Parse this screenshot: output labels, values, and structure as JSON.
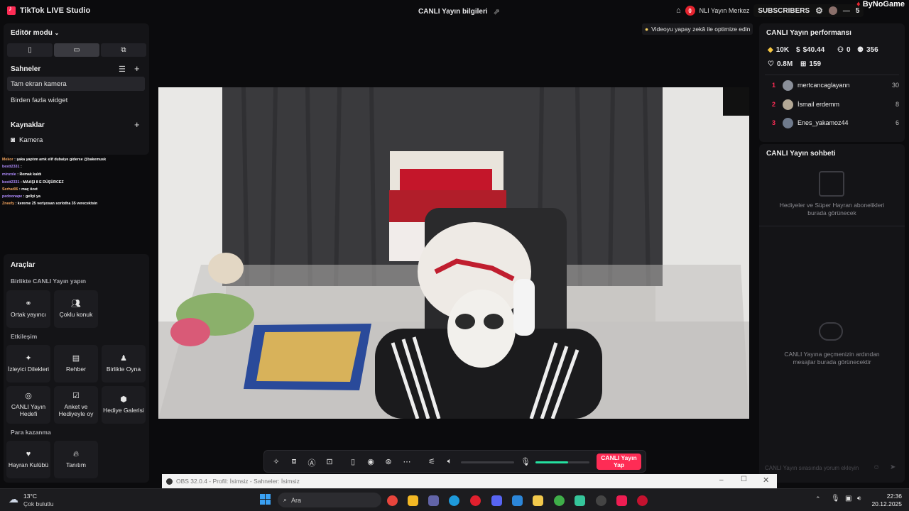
{
  "app": {
    "title": "TikTok LIVE Studio",
    "center_title": "CANLI Yayın bilgileri"
  },
  "top_right": {
    "notif_count": "0",
    "center_label": "NLI Yayın Merkez",
    "subs_label": "SUBSCRIBERS",
    "counter": "5",
    "brand": "ByNoGame"
  },
  "left": {
    "editor_mode": "Editör modu",
    "scenes_title": "Sahneler",
    "scenes": [
      "Tam ekran kamera",
      "Birden fazla widget"
    ],
    "sources_title": "Kaynaklar",
    "sources": [
      "Kamera"
    ]
  },
  "chat_overlay": [
    {
      "user": "Mekor",
      "msg": ": şaka yaptım amk elif dubaiye giderse @bakemusk"
    },
    {
      "user": "bestt2331",
      "msg": ":"
    },
    {
      "user": "minzole",
      "msg": ": Remak kaldı"
    },
    {
      "user": "bestt2331",
      "msg": ": MAAŞI 8 E DÜŞÜRCEZ"
    },
    {
      "user": "Serhat06",
      "msg": ": maç özet"
    },
    {
      "user": "pedoonape",
      "msg": ": geliyi ya"
    },
    {
      "user": "Zneefy",
      "msg": ": kereme 25 veriyosan sorlotha 35 verecektsin"
    }
  ],
  "tools": {
    "title": "Araçlar",
    "group1": "Birlikte CANLI Yayın yapın",
    "group1_items": [
      "Ortak yayıncı",
      "Çoklu konuk"
    ],
    "group2": "Etkileşim",
    "group2_items": [
      "İzleyici Dilekleri",
      "Rehber",
      "Birlikte Oyna",
      "CANLI Yayın Hedefi",
      "Anket ve Hediyeyle oy",
      "Hediye Galerisi"
    ],
    "group3": "Para kazanma",
    "group3_items": [
      "Hayran Kulübü",
      "Tanıtım"
    ]
  },
  "stage": {
    "optimize_hint": "Videoyu yapay zekâ ile optimize edin"
  },
  "controls": {
    "go_live": "CANLI Yayın Yap",
    "volume_level": 0.0,
    "mic_level": 0.6
  },
  "perf": {
    "title": "CANLI Yayın performansı",
    "stats": {
      "diamonds": "10K",
      "earnings": "$40.44",
      "new_followers": "0",
      "viewers": "356",
      "likes": "0.8M",
      "gifts": "159"
    },
    "ranking": [
      {
        "rank": "1",
        "name": "mertcancaglayann",
        "score": "30"
      },
      {
        "rank": "2",
        "name": "İsmail erdemm",
        "score": "8"
      },
      {
        "rank": "3",
        "name": "Enes_yakamoz44",
        "score": "6"
      }
    ]
  },
  "chat": {
    "title": "CANLI Yayın sohbeti",
    "gifts_empty": "Hediyeler ve Süper Hayran abonelikleri burada görünecek",
    "messages_empty": "CANLI Yayına geçmenizin ardından mesajlar burada görünecektir",
    "input_placeholder": "CANLI Yayın sırasında yorum ekleyin"
  },
  "obs": {
    "title": "OBS 32.0.4 - Profil: İsimsiz - Sahneler: İsimsiz"
  },
  "taskbar": {
    "temp": "13°C",
    "weather": "Çok bulutlu",
    "search": "Ara",
    "time": "22:36",
    "date": "20.12.2025"
  },
  "colors": {
    "accent": "#fe2c55",
    "panel": "#141417",
    "mic_green": "#25e0a0"
  }
}
